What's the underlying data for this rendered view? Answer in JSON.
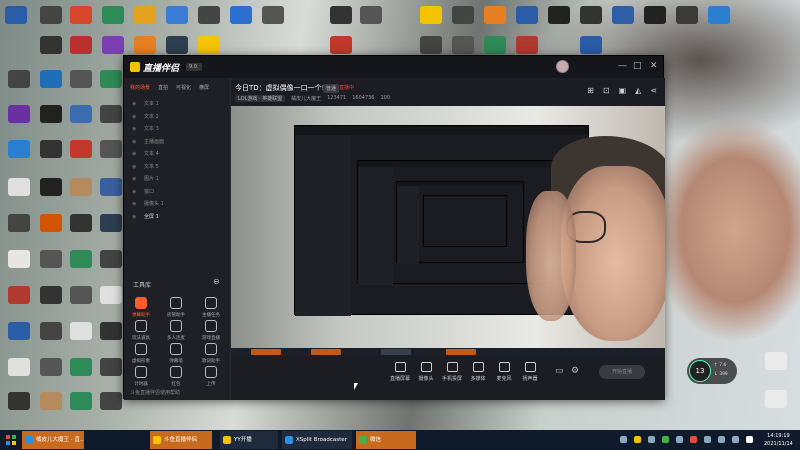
{
  "app": {
    "name": "直播伴侣",
    "version": "9.0.",
    "window_controls": [
      "—",
      "□",
      "✕"
    ]
  },
  "sidebar": {
    "tabs": [
      {
        "label": "我的场景",
        "active": true
      },
      {
        "label": "直拍",
        "active": false
      },
      {
        "label": "可视化",
        "active": false
      },
      {
        "label": "横屏",
        "active": false
      }
    ],
    "scenes": [
      {
        "label": "文本 1"
      },
      {
        "label": "文本 2"
      },
      {
        "label": "文本 3"
      },
      {
        "label": "主播画面"
      },
      {
        "label": "文本 4"
      },
      {
        "label": "文本 5"
      },
      {
        "label": "图片 1"
      },
      {
        "label": "窗口"
      },
      {
        "label": "摄像头 1"
      },
      {
        "label": "全屏 1",
        "active": true
      }
    ],
    "tools_title": "工具库",
    "tools": [
      {
        "label": "弹幕助手",
        "hot": true
      },
      {
        "label": "房管助手"
      },
      {
        "label": "主播任务"
      },
      {
        "label": "玩法道具"
      },
      {
        "label": "多人连麦"
      },
      {
        "label": "游戏直播"
      },
      {
        "label": "虚拟形象"
      },
      {
        "label": "弹幕墙"
      },
      {
        "label": "歌词助手"
      },
      {
        "label": "计时器"
      },
      {
        "label": "红包"
      },
      {
        "label": "上传"
      }
    ],
    "footer": "斗鱼直播伴侣使用帮助"
  },
  "room": {
    "title": "今日TD：虚拟偶像一口一个!",
    "tag": "普通",
    "live_status": "直播中",
    "meta": [
      "LOL游戏 · 英雄联盟",
      "橘皮儿大魔王",
      "123471",
      "1604736",
      "100"
    ]
  },
  "bottom_bar": {
    "items": [
      {
        "label": "直播屏幕"
      },
      {
        "label": "摄像头"
      },
      {
        "label": "手机投屏"
      },
      {
        "label": "多媒体"
      },
      {
        "label": "麦克风"
      },
      {
        "label": "扬声器"
      }
    ],
    "start_label": "开始直播"
  },
  "net_widget": {
    "percent": "13",
    "up": "7.6",
    "down": "399"
  },
  "taskbar": {
    "tasks": [
      {
        "label": "橘皮儿大魔王 - 直...",
        "style": "orange",
        "color": "#2d8fe3"
      },
      {
        "label": "斗鱼直播伴侣",
        "style": "orange",
        "color": "#f5c400"
      },
      {
        "label": "YY开播",
        "style": "dark",
        "color": "#f5c400"
      },
      {
        "label": "XSplit Broadcaster",
        "style": "dark",
        "color": "#2d8fe3"
      },
      {
        "label": "微信",
        "style": "orange",
        "color": "#45b04a"
      }
    ],
    "time": "14:19:19",
    "date": "2021/11/14"
  },
  "colors": {
    "accent": "#ff5b2e",
    "live": "#ff3b30",
    "app_bg": "#1c1d22",
    "taskbar": "#0f1a2b"
  }
}
